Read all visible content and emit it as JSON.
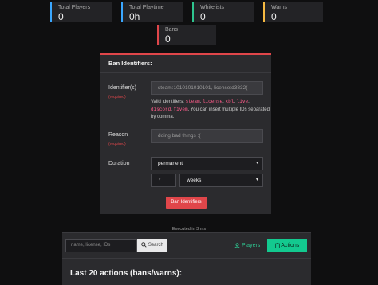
{
  "stats": [
    {
      "label": "Total Players",
      "value": "0",
      "color": "#3aa7ff"
    },
    {
      "label": "Total Playtime",
      "value": "0h",
      "color": "#3aa7ff"
    },
    {
      "label": "Whitelists",
      "value": "0",
      "color": "#2ec48f"
    },
    {
      "label": "Warns",
      "value": "0",
      "color": "#f5b942"
    },
    {
      "label": "Bans",
      "value": "0",
      "color": "#e0464a"
    }
  ],
  "ban_panel": {
    "title": "Ban Identifiers:",
    "identifiers_label": "Identifier(s)",
    "identifiers_required": "(required)",
    "identifiers_placeholder": "steam:1010101010101, license:d3832(",
    "help_prefix": "Valid identifiers: ",
    "help_codes": [
      "steam",
      "license",
      "xbl",
      "live",
      "discord",
      "fivem"
    ],
    "help_suffix": ". You can insert multiple IDs separated by comma.",
    "reason_label": "Reason",
    "reason_required": "(required)",
    "reason_placeholder": "doing bad things :(",
    "duration_label": "Duration",
    "duration_value": "permanent",
    "duration_amount": "7",
    "duration_unit": "weeks",
    "submit_label": "Ban Identifiers"
  },
  "executed_text": "Executed in 3 ms",
  "bottom": {
    "search_placeholder": "name, license, IDs",
    "search_button": "Search",
    "players_link": "Players",
    "actions_button": "Actions",
    "last_actions_title": "Last 20 actions (bans/warns):"
  }
}
